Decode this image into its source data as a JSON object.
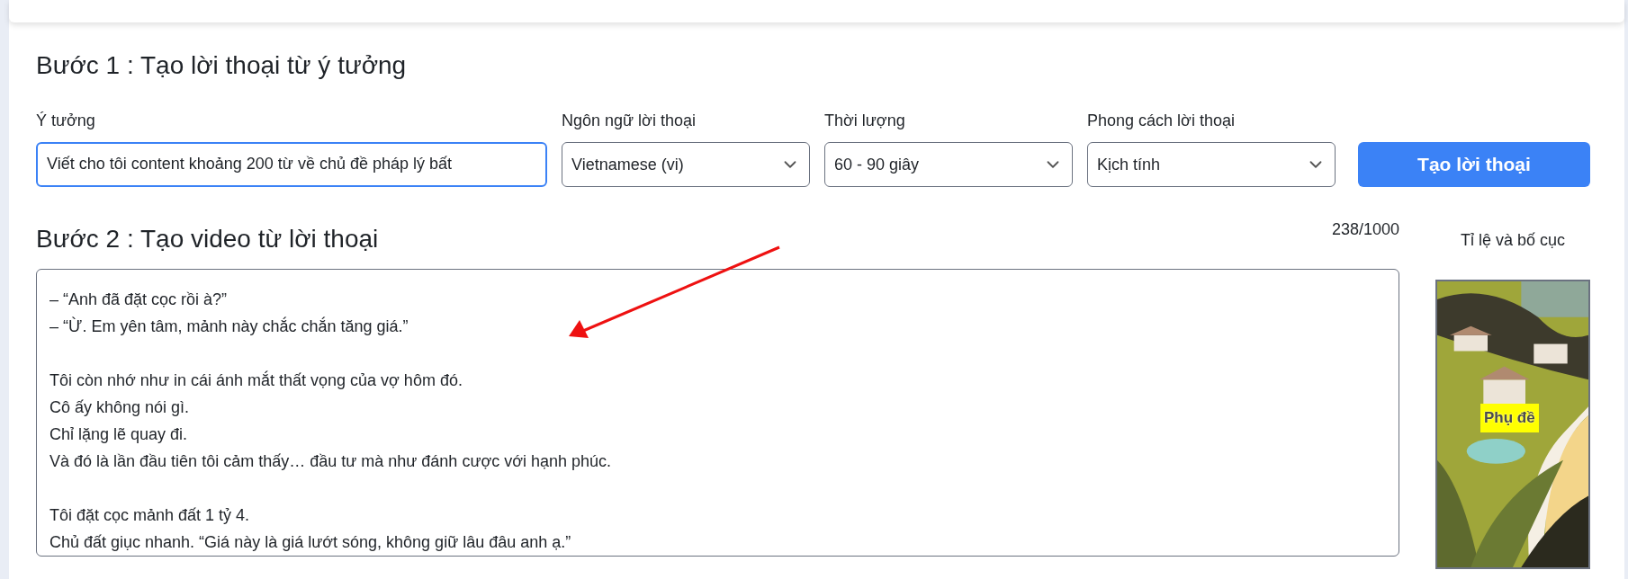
{
  "step1": {
    "title": "Bước 1 : Tạo lời thoại từ ý tưởng",
    "idea": {
      "label": "Ý tưởng",
      "value": "Viết cho tôi content khoảng 200 từ về chủ đề pháp lý bất"
    },
    "selects": [
      {
        "label": "Ngôn ngữ lời thoại",
        "value": "Vietnamese (vi)"
      },
      {
        "label": "Thời lượng",
        "value": "60 - 90 giây"
      },
      {
        "label": "Phong cách lời thoại",
        "value": "Kịch tính"
      }
    ],
    "button": "Tạo lời thoại"
  },
  "step2": {
    "title": "Bước 2 : Tạo video từ lời thoại",
    "counter": "238/1000",
    "script_paragraphs": [
      [
        "– “Anh đã đặt cọc rồi à?”",
        "– “Ừ. Em yên tâm, mảnh này chắc chắn tăng giá.”"
      ],
      [
        "Tôi còn nhớ như in cái ánh mắt thất vọng của vợ hôm đó.",
        "Cô ấy không nói gì.",
        "Chỉ lặng lẽ quay đi.",
        "Và đó là lần đầu tiên tôi cảm thấy… đầu tư mà như đánh cược với hạnh phúc."
      ],
      [
        "Tôi đặt cọc mảnh đất 1 tỷ 4.",
        "Chủ đất giục nhanh. “Giá này là giá lướt sóng, không giữ lâu đâu anh ạ.”"
      ]
    ],
    "layout": {
      "label": "Tỉ lệ và bố cục",
      "preview": {
        "kind": "picture",
        "caption": "Phụ đề"
      }
    }
  }
}
